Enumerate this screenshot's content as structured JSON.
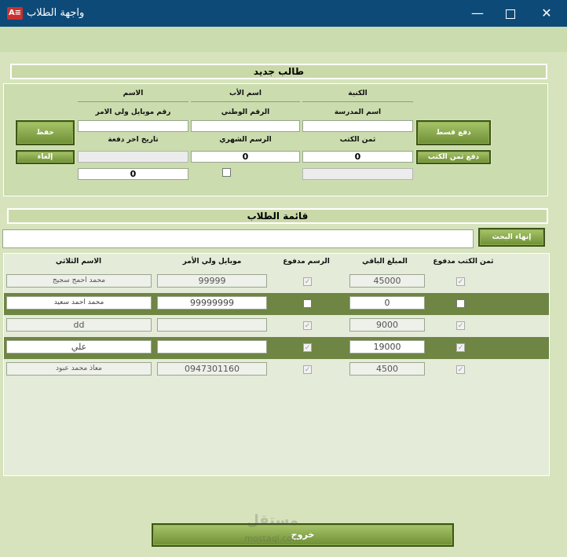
{
  "window": {
    "title": "واجهة الطلاب",
    "app_icon": "access-app-icon",
    "minimize": "—",
    "close": "✕"
  },
  "new_student": {
    "header": "طالب جديد",
    "labels": {
      "name": "الاسم",
      "father_name": "اسم الأب",
      "surname": "الكنية",
      "guardian_mobile": "رقم موبايل ولي الامر",
      "national_id": "الرقم الوطني",
      "school_name": "اسم المدرسة",
      "last_payment_date": "تاريخ اخر دفعة",
      "monthly_fee": "الرسم الشهري",
      "books_price": "ثمن الكتب"
    },
    "values": {
      "monthly_fee": "0",
      "books_price": "0",
      "remaining": "0"
    },
    "buttons": {
      "save": "حفظ",
      "cancel": "إلغاء",
      "pay_installment": "دفع قسط",
      "pay_books": "دفع ثمن الكتب"
    }
  },
  "students_list": {
    "header": "قائمة الطلاب",
    "end_search": "إنهاء البحث",
    "columns": {
      "full_name": "الاسم الثلاثي",
      "guardian_mobile": "موبايل ولي الأمر",
      "fee_paid": "الرسم مدفوع",
      "remaining": "المبلغ الباقي",
      "books_paid": "ثمن الكتب مدفوع"
    },
    "rows": [
      {
        "name": "محمد احمج سجيج",
        "mobile": "99999",
        "fee_paid": true,
        "remaining": "45000",
        "books_paid": true
      },
      {
        "name": "محمد احمد سعيد",
        "mobile": "99999999",
        "fee_paid": false,
        "remaining": "0",
        "books_paid": false
      },
      {
        "name": "dd",
        "mobile": "",
        "fee_paid": true,
        "remaining": "9000",
        "books_paid": true
      },
      {
        "name": "علي",
        "mobile": "",
        "fee_paid": true,
        "remaining": "19000",
        "books_paid": true
      },
      {
        "name": "معاذ محمد عبود",
        "mobile": "0947301160",
        "fee_paid": true,
        "remaining": "4500",
        "books_paid": true
      }
    ]
  },
  "exit_button": "خروج",
  "watermark": {
    "brand": "مستقل",
    "site": "mostaql.com"
  }
}
